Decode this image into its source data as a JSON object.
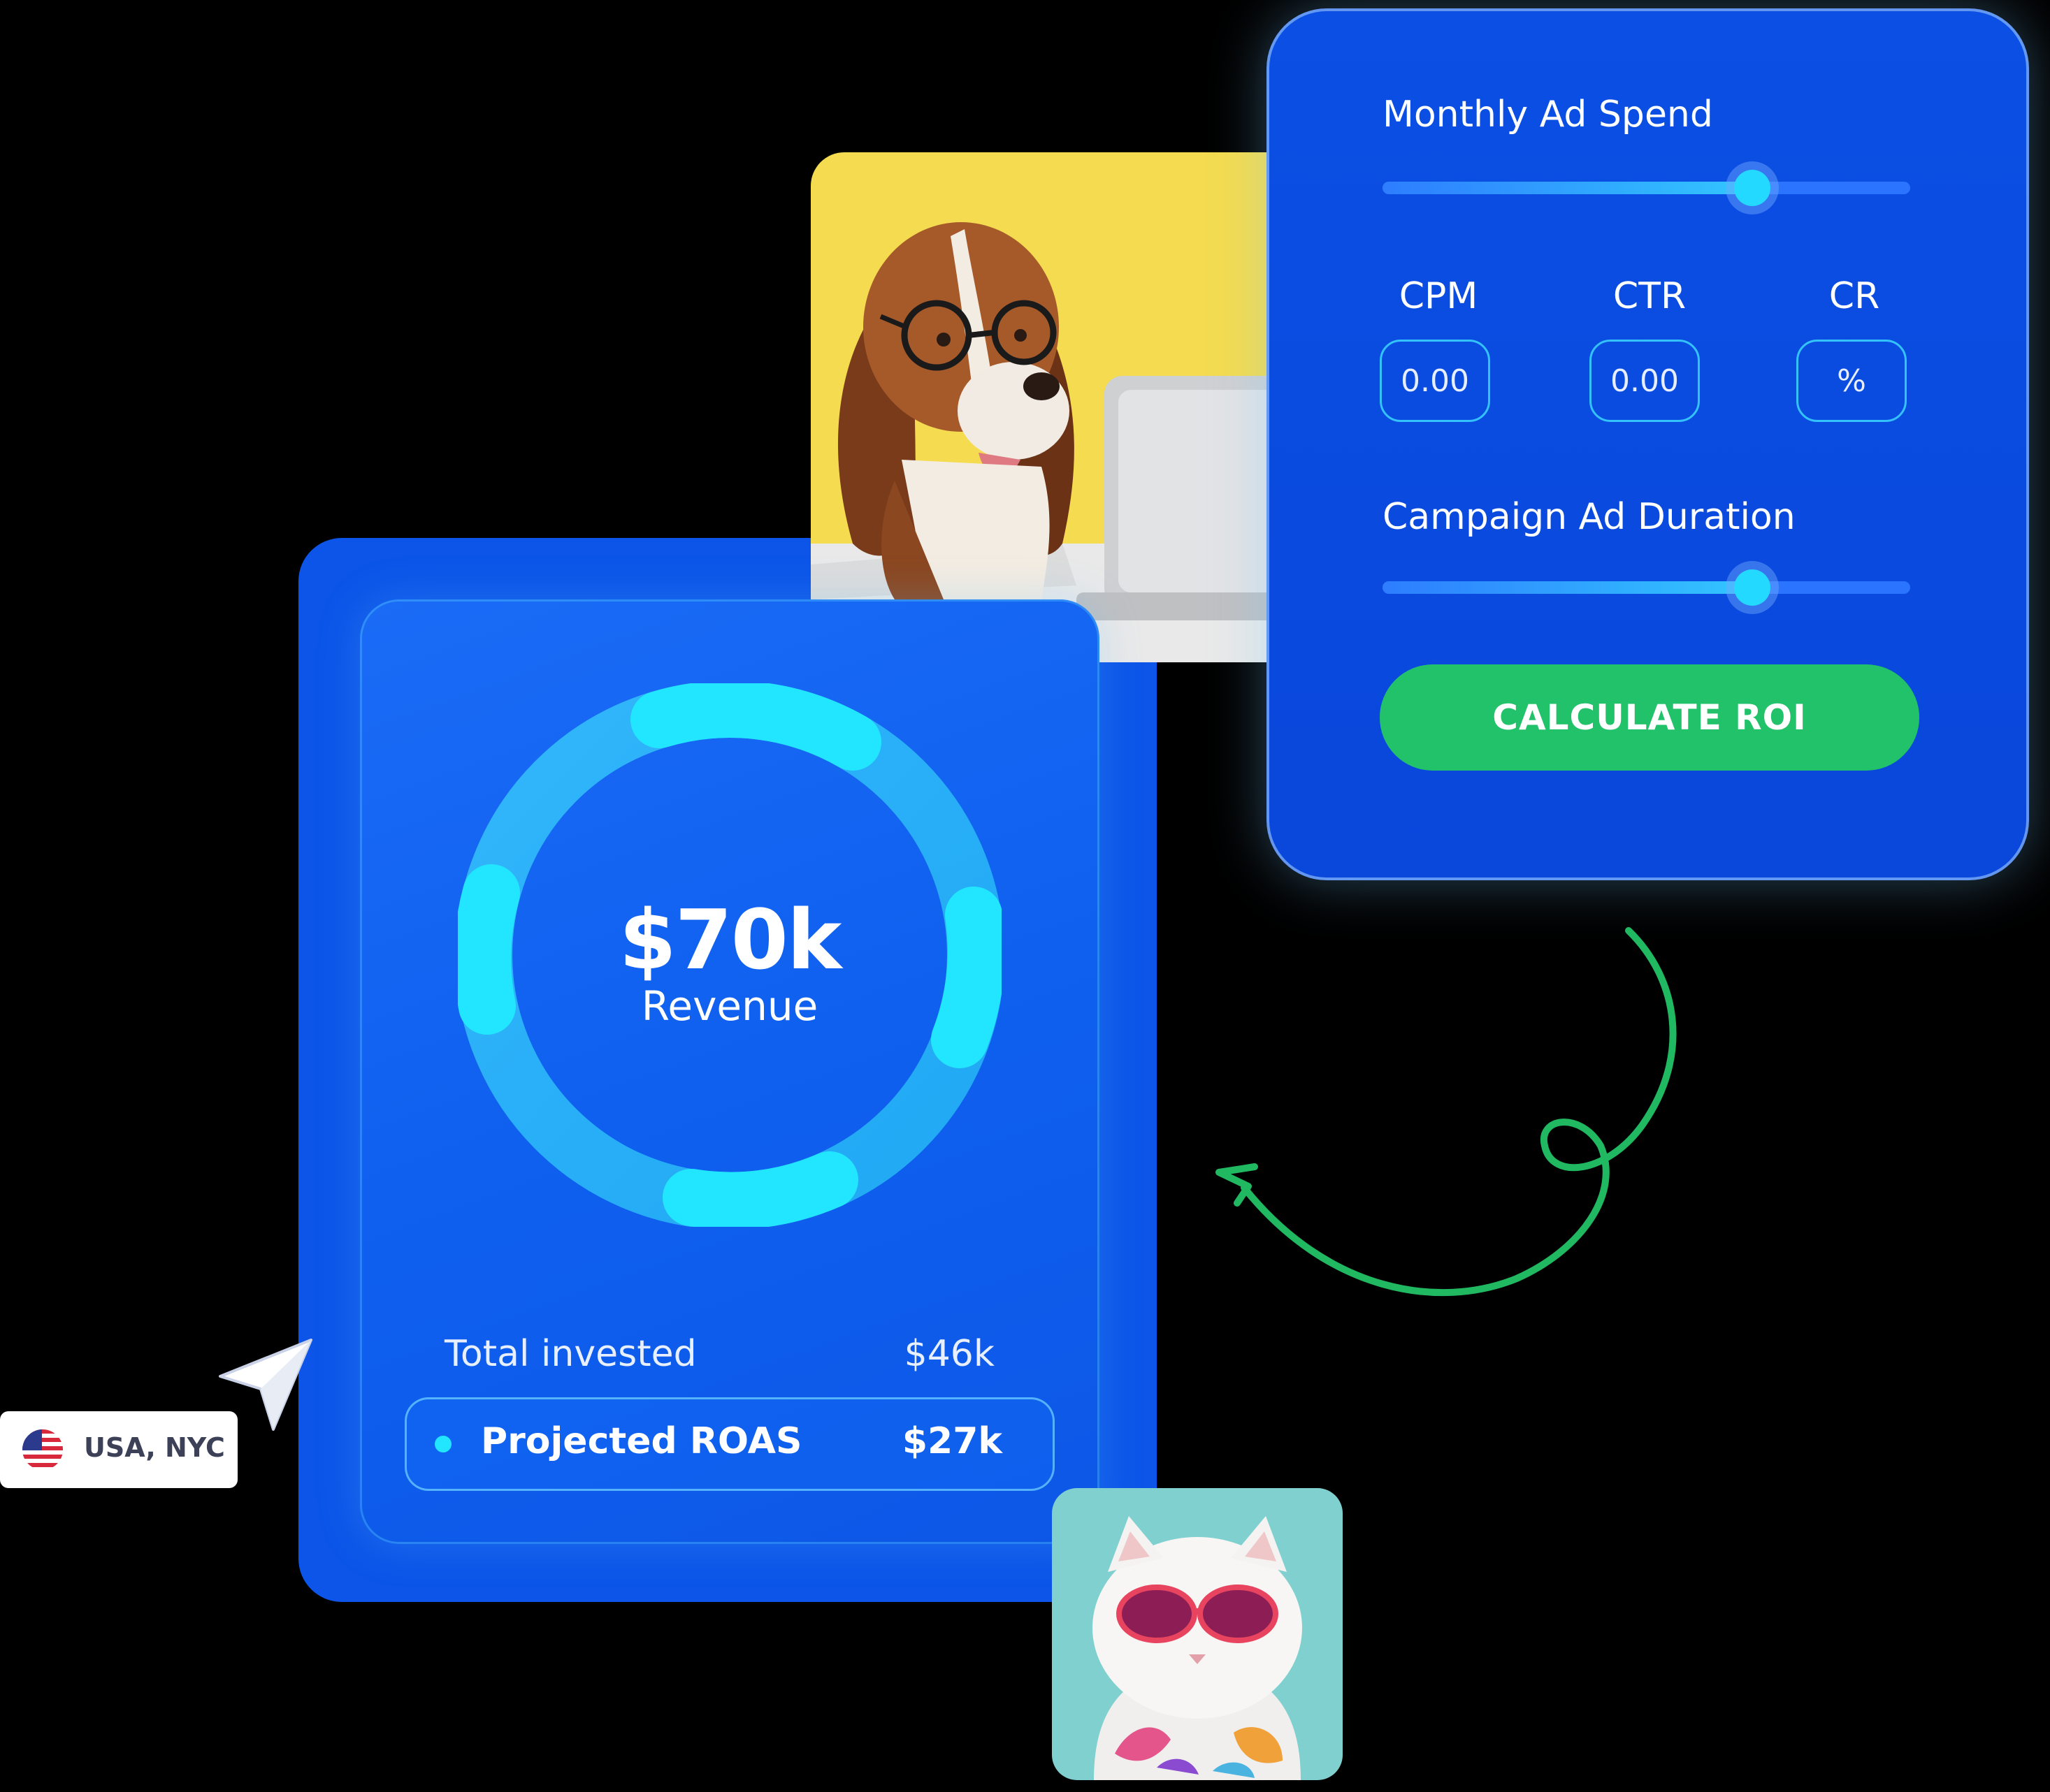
{
  "calculator": {
    "ad_spend_label": "Monthly Ad Spend",
    "ad_spend_level": 0.7,
    "metrics": [
      {
        "label": "CPM",
        "placeholder": "0.00"
      },
      {
        "label": "CTR",
        "placeholder": "0.00"
      },
      {
        "label": "CR",
        "placeholder": "%"
      }
    ],
    "duration_label": "Campaign Ad Duration",
    "duration_level": 0.7,
    "button_label": "CALCULATE ROI"
  },
  "result": {
    "revenue_value": "$70k",
    "revenue_label": "Revenue",
    "total_invested_label": "Total invested",
    "total_invested_value": "$46k",
    "projected_roas_label": "Projected ROAS",
    "projected_roas_value": "$27k"
  },
  "location": {
    "text": "USA, NYC"
  },
  "colors": {
    "card_blue": "#0b4fe4",
    "ring_cyan": "#22e6ff",
    "button_green": "#22c26b",
    "arrow_green": "#20b861"
  },
  "icons": [
    "usa-flag-icon",
    "cursor-pointer-icon",
    "curly-arrow-icon"
  ]
}
